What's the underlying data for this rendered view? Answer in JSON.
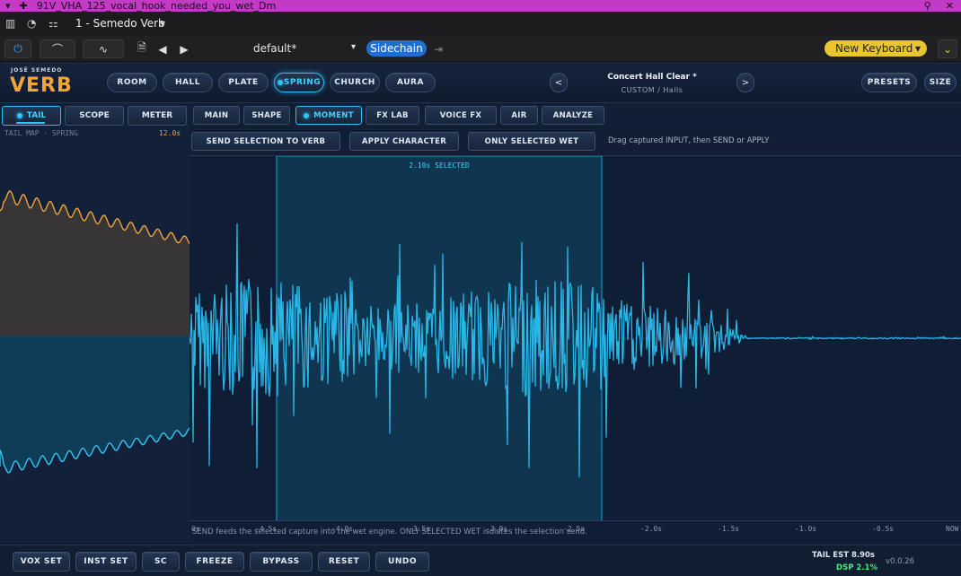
{
  "host": {
    "file_title": "91V_VHA_125_vocal_hook_needed_you_wet_Dm",
    "track_label": "1 - Semedo Verb",
    "preset": "default*",
    "sidechain_label": "Sidechain",
    "keyboard_label": "New Keyboard"
  },
  "brand": {
    "small": "JOSÉ SEMEDO",
    "big": "VERB"
  },
  "room_types": [
    "ROOM",
    "HALL",
    "PLATE",
    "SPRING",
    "CHURCH",
    "AURA"
  ],
  "active_room": "SPRING",
  "preset_nav": {
    "prev": "<",
    "next": ">",
    "name": "Concert Hall Clear *",
    "category": "CUSTOM / Halls"
  },
  "header_buttons": {
    "presets": "PRESETS",
    "size": "SIZE"
  },
  "left_tabs": [
    "TAIL",
    "SCOPE",
    "METER"
  ],
  "active_left_tab": "TAIL",
  "tail_map": {
    "label": "TAIL MAP - SPRING",
    "time": "12.0s"
  },
  "main_tabs": [
    "MAIN",
    "SHAPE",
    "MOMENT",
    "FX LAB",
    "VOICE FX",
    "AIR",
    "ANALYZE"
  ],
  "active_main_tab": "MOMENT",
  "actions": {
    "send": "SEND SELECTION TO VERB",
    "apply": "APPLY CHARACTER",
    "only_wet": "ONLY SELECTED WET",
    "hint": "Drag captured INPUT, then SEND or APPLY"
  },
  "selection_label": "2.10s SELECTED",
  "time_axis": [
    "0s",
    "-4.5s",
    "-4.0s",
    "-3.5s",
    "-3.0s",
    "-2.5s",
    "-2.0s",
    "-1.5s",
    "-1.0s",
    "-0.5s",
    "NOW"
  ],
  "footnote": "SEND feeds the selected capture into the wet engine. ONLY SELECTED WET isolates the selection send.",
  "bottom_buttons": [
    "VOX SET",
    "INST SET",
    "SC",
    "FREEZE",
    "BYPASS",
    "RESET",
    "UNDO"
  ],
  "status": {
    "tail_est": "TAIL EST 8.90s",
    "dsp": "DSP 2.1%",
    "version": "v0.0.26"
  },
  "colors": {
    "accent": "#2fc6ff",
    "brand": "#f0a43a",
    "wave": "#29b8e6",
    "selection": "#0f3550"
  }
}
